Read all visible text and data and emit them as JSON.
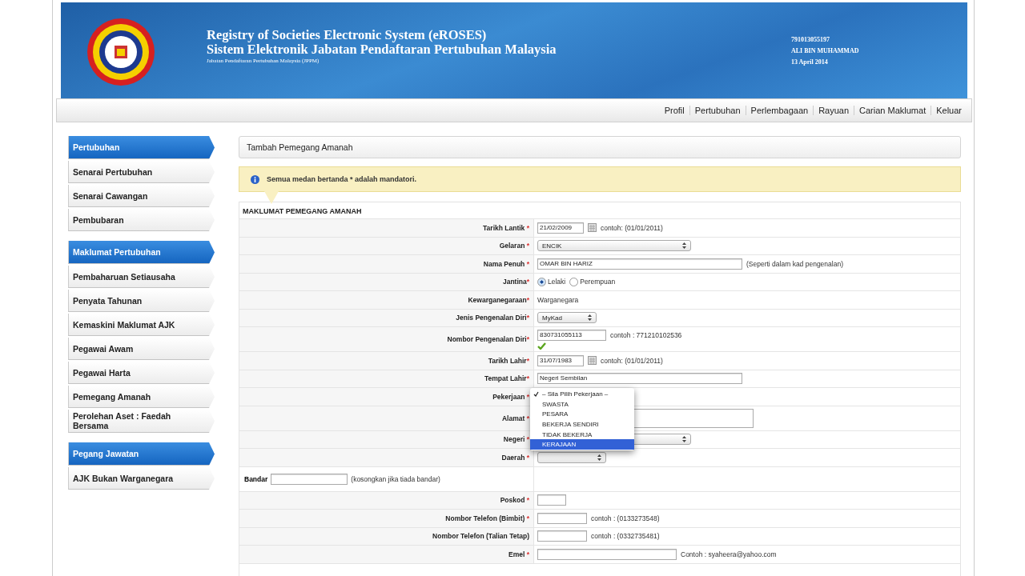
{
  "header": {
    "title_en": "Registry of Societies Electronic System (eROSES)",
    "title_ms": "Sistem Elektronik Jabatan Pendaftaran Pertubuhan Malaysia",
    "subtitle": "Jabatan Pendaftaran Pertubuhan Malaysia (JPPM)",
    "user_id": "791013055197",
    "user_name": "ALI BIN MUHAMMAD",
    "date": "13 April 2014"
  },
  "nav": [
    "Profil",
    "Pertubuhan",
    "Perlembagaan",
    "Rayuan",
    "Carian Maklumat",
    "Keluar"
  ],
  "sidebar": [
    {
      "kind": "header",
      "label": "Pertubuhan"
    },
    {
      "kind": "item",
      "label": "Senarai Pertubuhan"
    },
    {
      "kind": "item",
      "label": "Senarai Cawangan"
    },
    {
      "kind": "item",
      "label": "Pembubaran"
    },
    {
      "kind": "header",
      "label": "Maklumat Pertubuhan"
    },
    {
      "kind": "item",
      "label": "Pembaharuan Setiausaha"
    },
    {
      "kind": "item",
      "label": "Penyata Tahunan"
    },
    {
      "kind": "item",
      "label": "Kemaskini Maklumat AJK"
    },
    {
      "kind": "item",
      "label": "Pegawai Awam"
    },
    {
      "kind": "item",
      "label": "Pegawai Harta"
    },
    {
      "kind": "item",
      "label": "Pemegang Amanah"
    },
    {
      "kind": "item",
      "label": "Perolehan Aset : Faedah Bersama"
    },
    {
      "kind": "header",
      "label": "Pegang Jawatan"
    },
    {
      "kind": "item",
      "label": "AJK Bukan Warganegara"
    }
  ],
  "page_title": "Tambah Pemegang Amanah",
  "notice": "Semua medan bertanda * adalah mandatori.",
  "section_title": "MAKLUMAT PEMEGANG AMANAH",
  "rows": [
    {
      "kind": "date",
      "label": "Tarikh Lantik",
      "star": " *",
      "value": "21/02/2009",
      "hint": "contoh: (01/01/2011)"
    },
    {
      "kind": "select",
      "label": "Gelaran",
      "star": " *",
      "value": "ENCIK"
    },
    {
      "kind": "text",
      "label": "Nama Penuh",
      "star": " *",
      "value": "OMAR BIN HARIZ",
      "hint": "(Seperti dalam kad pengenalan)"
    },
    {
      "kind": "radio",
      "label": "Jantina",
      "star": "*",
      "options": [
        {
          "label": "Lelaki",
          "selected": true
        },
        {
          "label": "Perempuan",
          "selected": false
        }
      ]
    },
    {
      "kind": "static",
      "label": "Kewarganegaraan",
      "star": "*",
      "value": "Warganegara"
    },
    {
      "kind": "select",
      "label": "Jenis Pengenalan Diri",
      "star": "*",
      "value": "MyKad"
    },
    {
      "kind": "text",
      "label": "Nombor Pengenalan Diri",
      "star": "*",
      "value": "830731055113",
      "hint": "contoh : 771210102536",
      "valid": true
    },
    {
      "kind": "date",
      "label": "Tarikh Lahir",
      "star": "*",
      "value": "31/07/1983",
      "hint": "contoh: (01/01/2011)"
    },
    {
      "kind": "text",
      "label": "Tempat Lahir",
      "star": "*",
      "value": "Negeri Sembilan"
    },
    {
      "kind": "dropdown",
      "label": "Pekerjaan",
      "star": " *",
      "options": [
        {
          "label": "– Sila Pilih Pekerjaan –",
          "checked": true,
          "highlighted": false
        },
        {
          "label": "SWASTA",
          "checked": false,
          "highlighted": false
        },
        {
          "label": "PESARA",
          "checked": false,
          "highlighted": false
        },
        {
          "label": "BEKERJA SENDIRI",
          "checked": false,
          "highlighted": false
        },
        {
          "label": "TIDAK BEKERJA",
          "checked": false,
          "highlighted": false
        },
        {
          "label": "KERAJAAN",
          "checked": false,
          "highlighted": true
        }
      ]
    },
    {
      "kind": "textarea",
      "label": "Alamat",
      "star": " *"
    },
    {
      "kind": "select",
      "label": "Negeri",
      "star": " *"
    },
    {
      "kind": "select",
      "label": "Daerah",
      "star": " *"
    },
    {
      "kind": "bandar",
      "label": "Bandar",
      "hint": "(kosongkan jika tiada bandar)"
    },
    {
      "kind": "text",
      "label": "Poskod",
      "star": " *"
    },
    {
      "kind": "text",
      "label": "Nombor Telefon (Bimbit)",
      "star": " *",
      "hint": "contoh : (0133273548)"
    },
    {
      "kind": "text",
      "label": "Nombor Telefon (Talian Tetap)",
      "hint": "contoh : (0332735481)"
    },
    {
      "kind": "text",
      "label": "Emel",
      "star": " *",
      "hint": "Contoh : syaheera@yahoo.com"
    }
  ]
}
